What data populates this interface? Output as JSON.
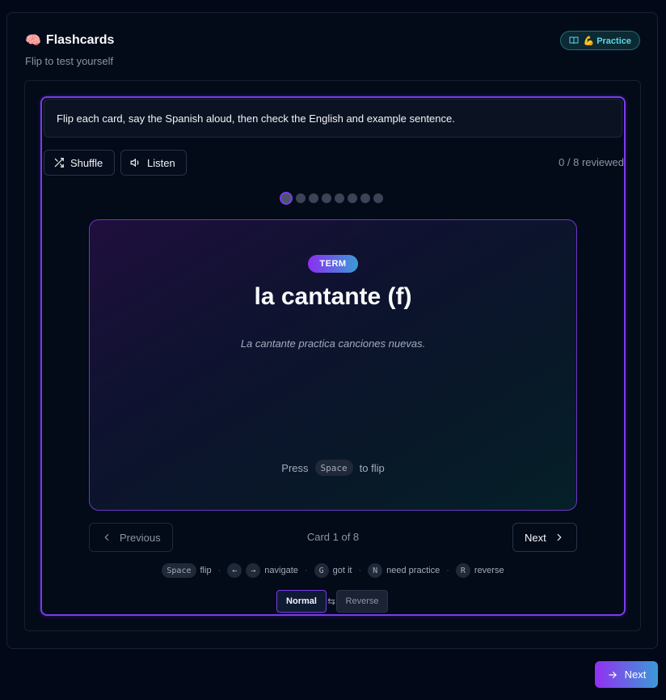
{
  "header": {
    "title": "Flashcards",
    "brain_emoji": "🧠",
    "subtitle": "Flip to test yourself",
    "practice_badge": "💪 Practice"
  },
  "instructions": "Flip each card, say the Spanish aloud, then check the English and example sentence.",
  "toolbar": {
    "shuffle_label": "Shuffle",
    "listen_label": "Listen",
    "reviewed": "0 / 8 reviewed"
  },
  "progress": {
    "current": 1,
    "total": 8
  },
  "card": {
    "side_label": "TERM",
    "term": "la cantante (f)",
    "example": "La cantante practica canciones nuevas.",
    "hint_prefix": "Press",
    "hint_key": "Space",
    "hint_suffix": "to flip"
  },
  "navigation": {
    "previous_label": "Previous",
    "next_label": "Next",
    "card_count": "Card 1 of 8"
  },
  "shortcuts": {
    "space_key": "Space",
    "space_desc": "flip",
    "left_key": "←",
    "right_key": "→",
    "nav_desc": "navigate",
    "g_key": "G",
    "g_desc": "got it",
    "n_key": "N",
    "n_desc": "need practice",
    "r_key": "R",
    "r_desc": "reverse"
  },
  "mode": {
    "normal_label": "Normal",
    "reverse_label": "Reverse"
  },
  "footer": {
    "next_label": "Next"
  },
  "colors": {
    "accent": "#7c3aed",
    "teal": "#5ed6e6",
    "background": "#020817"
  }
}
